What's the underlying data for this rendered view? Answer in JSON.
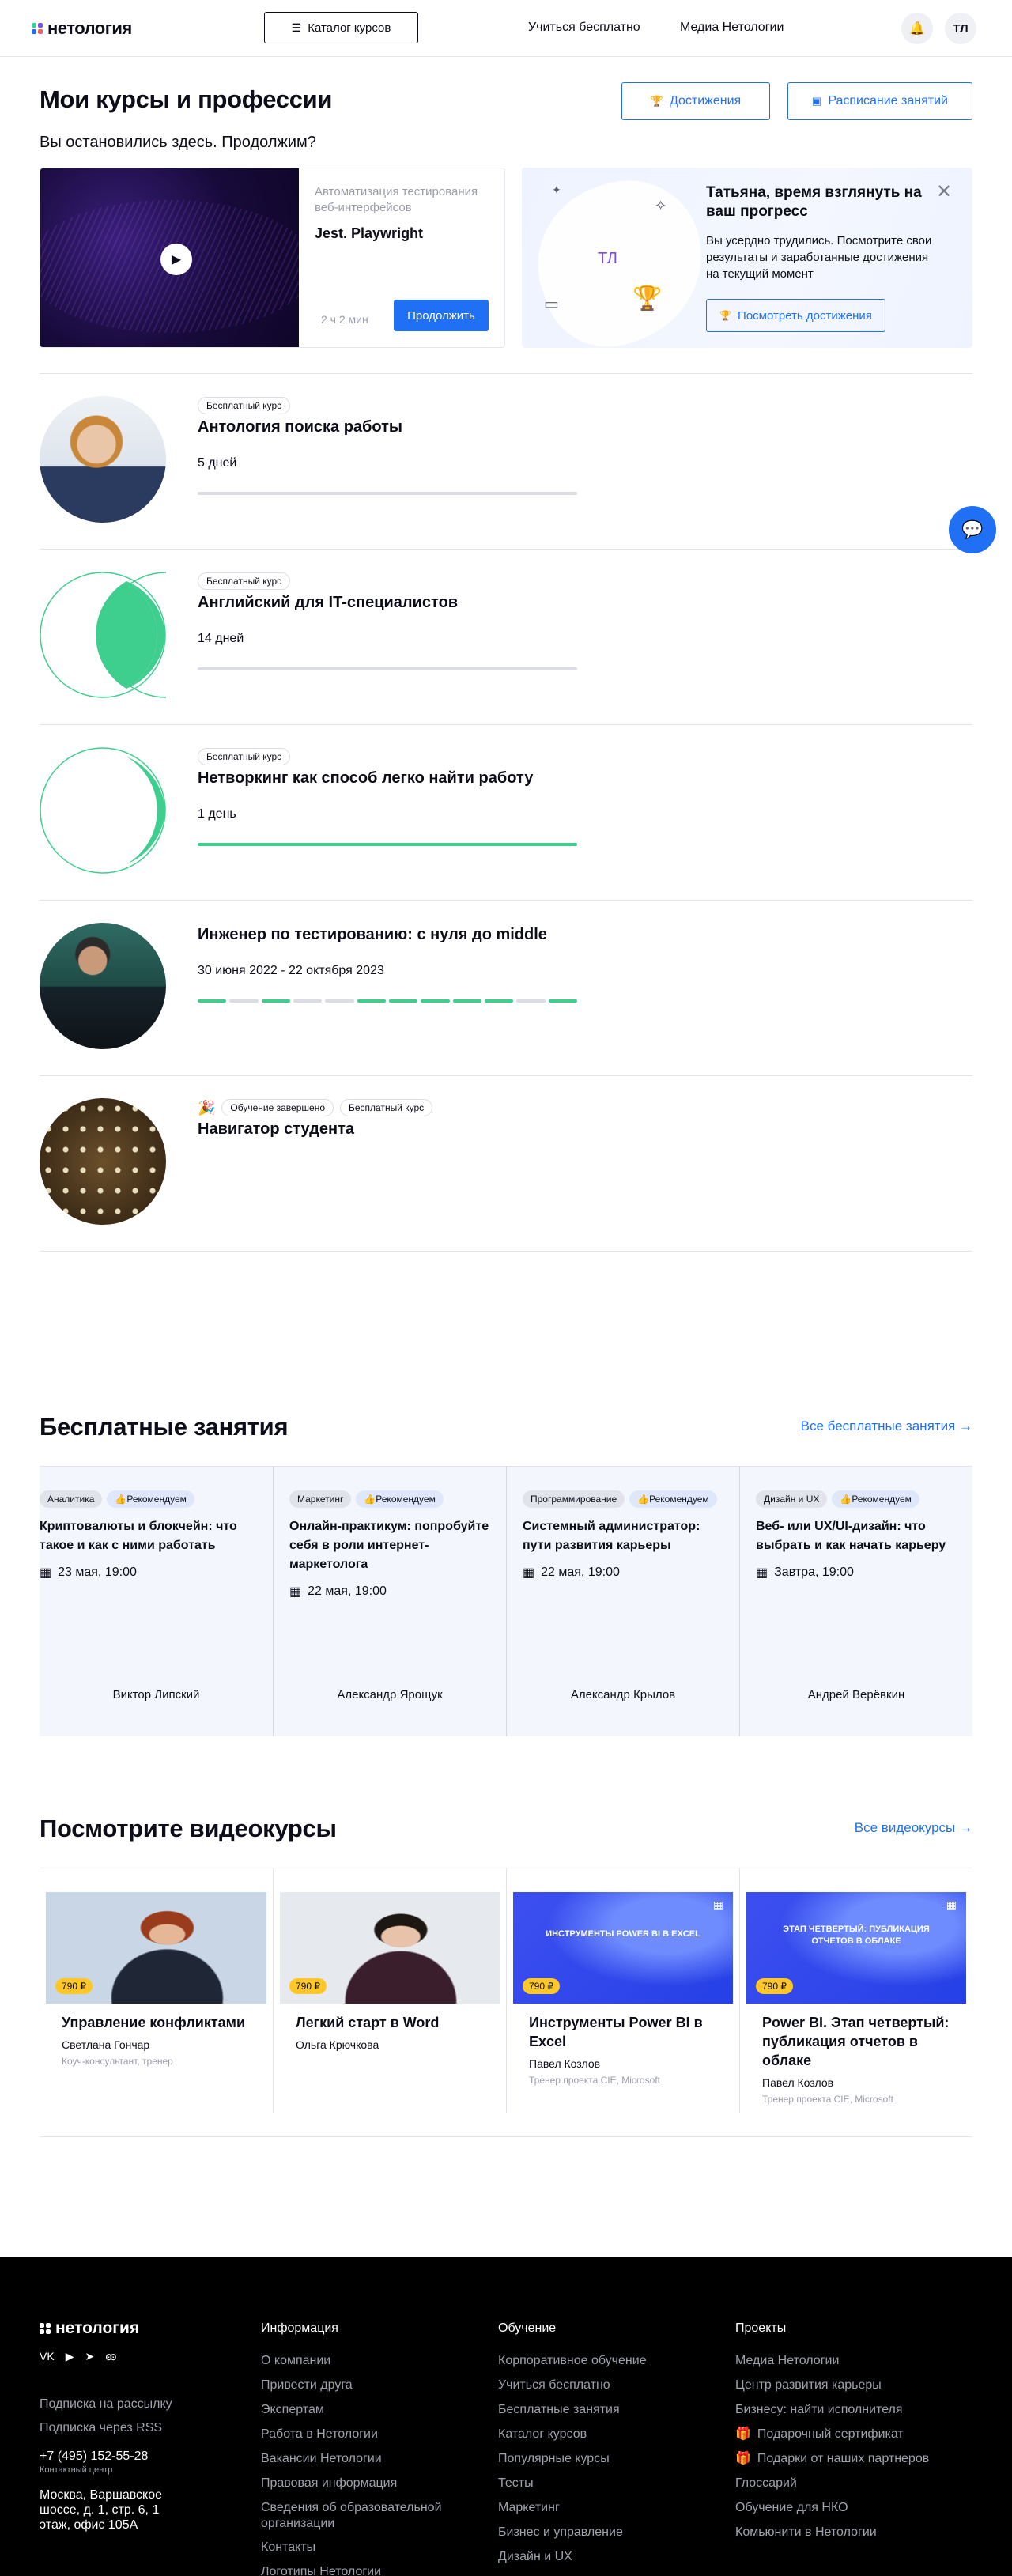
{
  "header": {
    "logo_text": "нетология",
    "catalog_label": "Каталог курсов",
    "nav": [
      "Учиться бесплатно",
      "Медиа Нетологии"
    ],
    "avatar_initials": "ТЛ"
  },
  "page": {
    "title": "Мои курсы и профессии",
    "achievements_label": "Достижения",
    "schedule_label": "Расписание занятий",
    "subtitle": "Вы остановились здесь. Продолжим?"
  },
  "continue_card": {
    "category": "Автоматизация тестирования веб-интерфейсов",
    "title": "Jest. Playwright",
    "time": "2 ч 2 мин",
    "button": "Продолжить"
  },
  "progress_card": {
    "initials": "ТЛ",
    "title": "Татьяна, время взглянуть на ваш прогресс",
    "text": "Вы усердно трудились. Посмотрите свои результаты и заработанные достижения на текущий момент",
    "button": "Посмотреть достижения"
  },
  "courses": [
    {
      "badges": [
        "Бесплатный курс"
      ],
      "title": "Антология поиска работы",
      "meta": "5 дней",
      "progress": 0.0
    },
    {
      "badges": [
        "Бесплатный курс"
      ],
      "title": "Английский для IT-специалистов",
      "meta": "14 дней",
      "progress": 0.0
    },
    {
      "badges": [
        "Бесплатный курс"
      ],
      "title": "Нетворкинг как способ легко найти работу",
      "meta": "1 день",
      "progress": 1.0
    },
    {
      "badges": [],
      "title": "Инженер по тестированию: с нуля до middle",
      "meta": "30 июня 2022 - 22 октября 2023",
      "segments_done": [
        1,
        0,
        1,
        0,
        0,
        1,
        1,
        1,
        1,
        1,
        0,
        1
      ]
    },
    {
      "badges": [
        "Обучение завершено",
        "Бесплатный курс"
      ],
      "title": "Навигатор студента",
      "meta": ""
    }
  ],
  "free": {
    "title": "Бесплатные занятия",
    "link": "Все бесплатные занятия →",
    "cards": [
      {
        "tag": "Аналитика",
        "rec": "👍Рекомендуем",
        "title": "Криптовалюты и блокчейн: что такое и как с ними работать",
        "date": "23 мая, 19:00",
        "author": "Виктор Липский"
      },
      {
        "tag": "Маркетинг",
        "rec": "👍Рекомендуем",
        "title": "Онлайн-практикум: попробуйте себя в роли интернет-маркетолога",
        "date": "22 мая, 19:00",
        "author": "Александр Ярощук"
      },
      {
        "tag": "Программирование",
        "rec": "👍Рекомендуем",
        "title": "Системный администратор: пути развития карьеры",
        "date": "22 мая, 19:00",
        "author": "Александр Крылов"
      },
      {
        "tag": "Дизайн и UX",
        "rec": "👍Рекомендуем",
        "title": "Веб- или UX/UI-дизайн: что выбрать и как начать карьеру",
        "date": "Завтра, 19:00",
        "author": "Андрей Верёвкин"
      }
    ]
  },
  "videos": {
    "title": "Посмотрите видеокурсы",
    "link": "Все видеокурсы →",
    "cards": [
      {
        "price": "790 ₽",
        "title": "Управление конфликтами",
        "author": "Светлана Гончар",
        "role": "Коуч-консультант, тренер",
        "cover": "photo-a"
      },
      {
        "price": "790 ₽",
        "title": "Легкий старт в Word",
        "author": "Ольга Крючкова",
        "role": "",
        "cover": "photo-b"
      },
      {
        "price": "790 ₽",
        "title": "Инструменты Power BI в Excel",
        "author": "Павел Козлов",
        "role": "Тренер проекта CIE, Microsoft",
        "cover": "blue",
        "cover_text": "ИНСТРУМЕНТЫ POWER BI В EXCEL"
      },
      {
        "price": "790 ₽",
        "title": "Power BI. Этап четвертый: публикация отчетов в облаке",
        "author": "Павел Козлов",
        "role": "Тренер проекта CIE, Microsoft",
        "cover": "blue",
        "cover_text": "ЭТАП ЧЕТВЕРТЫЙ: ПУБЛИКАЦИЯ ОТЧЕТОВ В ОБЛАКЕ"
      }
    ]
  },
  "footer": {
    "logo_text": "нетология",
    "left": [
      "Подписка на рассылку",
      "Подписка через RSS",
      "+7 (495) 152-55-28",
      "Контактный центр",
      "Москва, Варшавское шоссе, д. 1, стр. 6, 1 этаж, офис 105А"
    ],
    "columns": [
      {
        "head": "Информация",
        "items": [
          "О компании",
          "Привести друга",
          "Экспертам",
          "Работа в Нетологии",
          "Вакансии Нетологии",
          "Правовая информация",
          "Сведения об образовательной организации",
          "Контакты",
          "Логотипы Нетологии"
        ]
      },
      {
        "head": "Обучение",
        "items": [
          "Корпоративное обучение",
          "Учиться бесплатно",
          "Бесплатные занятия",
          "Каталог курсов",
          "Популярные курсы",
          "Тесты",
          "Маркетинг",
          "Бизнес и управление",
          "Дизайн и UX"
        ]
      },
      {
        "head": "Проекты",
        "items": [
          "Медиа Нетологии",
          "Центр развития карьеры",
          "Бизнесу: найти исполнителя",
          "Подарочный сертификат",
          "Подарки от наших партнеров",
          "Глоссарий",
          "Обучение для НКО",
          "Комьюнити в Нетологии"
        ]
      }
    ]
  },
  "colors": {
    "accent": "#1f70f5",
    "green": "#3ecf8e",
    "price": "#ffc828"
  }
}
